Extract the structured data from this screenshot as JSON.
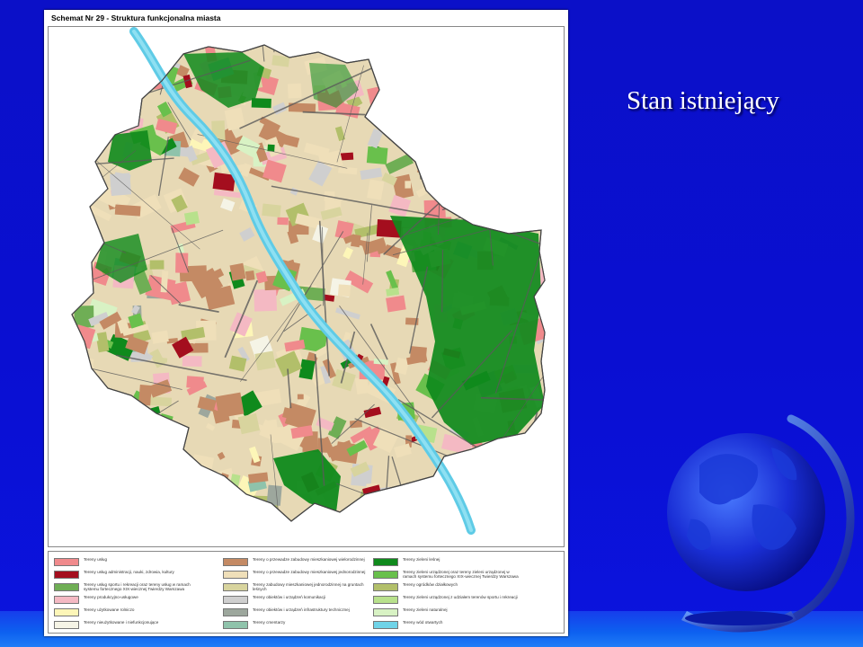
{
  "slide": {
    "title": "Stan istniejący",
    "colors": {
      "background": "#0b10cf",
      "title_text": "#ffffff",
      "bottom_band": "#1e7cf2"
    },
    "decorations": [
      "globe-icon"
    ]
  },
  "map": {
    "title": "Schemat Nr 29 - Struktura funkcjonalna miasta",
    "legend": [
      {
        "label": "Tereny usług",
        "color": "#f08a8c"
      },
      {
        "label": "Tereny usług administracji, nauki, zdrowia, kultury",
        "color": "#a40e1e"
      },
      {
        "label": "Tereny usług sportu i rekreacji oraz tereny usług w ramach systemu fortecznego XIX-wiecznej Twierdzy Warszawa",
        "color": "#6fae55"
      },
      {
        "label": "Tereny produkcyjno-usługowe",
        "color": "#f4b9c3"
      },
      {
        "label": "Tereny użytkowane rolniczo",
        "color": "#fdf6b8"
      },
      {
        "label": "Tereny nieużytkowane i niefunkcjonujące",
        "color": "#f5f4e6"
      },
      {
        "label": "Tereny o przewadze zabudowy mieszkaniowej wielorodzinnej",
        "color": "#c48a64"
      },
      {
        "label": "Tereny o przewadze zabudowy mieszkaniowej jednorodzinnej",
        "color": "#efdfb9"
      },
      {
        "label": "Tereny zabudowy mieszkaniowej jednorodzinnej na gruntach leśnych",
        "color": "#d8d49e"
      },
      {
        "label": "Tereny obiektów i urządzeń komunikacji",
        "color": "#cfcfcf"
      },
      {
        "label": "Tereny obiektów i urządzeń infrastruktury technicznej",
        "color": "#9da79d"
      },
      {
        "label": "Tereny cmentarzy",
        "color": "#8fc3ab"
      },
      {
        "label": "Tereny zieleni leśnej",
        "color": "#0f8a1c"
      },
      {
        "label": "Tereny zieleni urządzonej oraz tereny zieleni urządzonej w ramach systemu fortecznego XIX-wiecznej Twierdzy Warszawa",
        "color": "#69c04c"
      },
      {
        "label": "Tereny ogródków działkowych",
        "color": "#b2bf6a"
      },
      {
        "label": "Tereny zieleni urządzonej z udziałem terenów sportu i rekreacji",
        "color": "#b8e18c"
      },
      {
        "label": "Tereny zieleni naturalnej",
        "color": "#d8f2c4"
      },
      {
        "label": "Tereny wód otwartych",
        "color": "#6fd3e8"
      }
    ]
  }
}
